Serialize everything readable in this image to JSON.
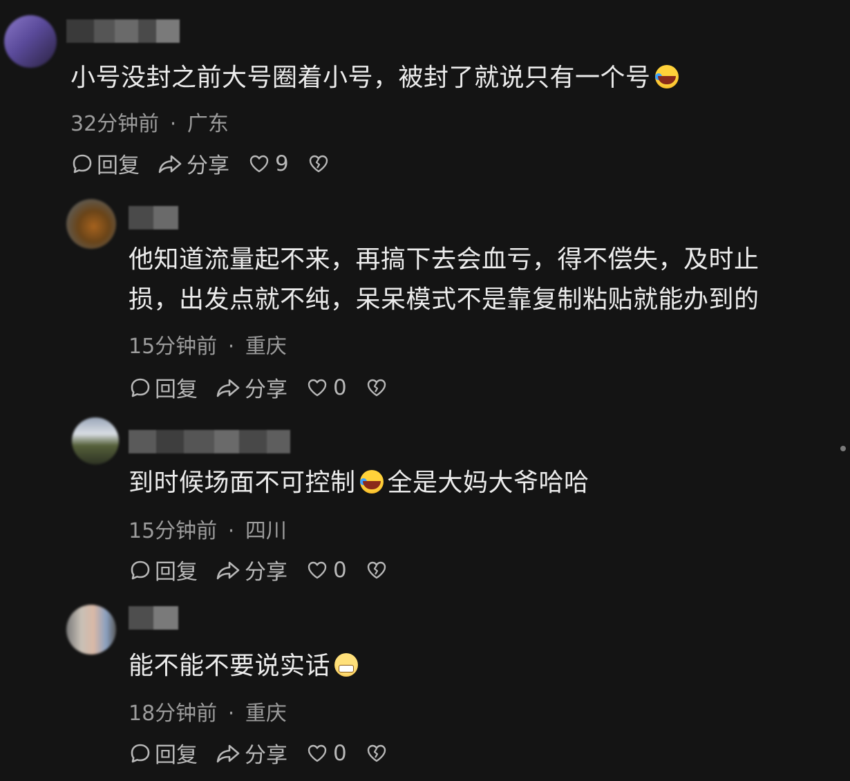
{
  "comments": [
    {
      "text_before": "小号没封之前大号圈着小号，被封了就说只有一个号",
      "emoji": "laugh-cry-emoji",
      "text_after": "",
      "time": "32分钟前",
      "location": "广东",
      "likes": "9"
    },
    {
      "text_line1": "他知道流量起不来，再搞下去会血亏，得不偿失，及时止",
      "text_line2": "损，出发点就不纯，呆呆模式不是靠复制粘贴就能办到的",
      "time": "15分钟前",
      "location": "重庆",
      "likes": "0"
    },
    {
      "text_before": "到时候场面不可控制",
      "emoji": "laugh-cry-emoji",
      "text_after": "全是大妈大爷哈哈",
      "time": "15分钟前",
      "location": "四川",
      "likes": "0"
    },
    {
      "text_before": "能不能不要说实话",
      "emoji": "grin-emoji",
      "text_after": "",
      "time": "18分钟前",
      "location": "重庆",
      "likes": "0"
    }
  ],
  "actions": {
    "reply_label": "回复",
    "share_label": "分享"
  },
  "separator": "·"
}
